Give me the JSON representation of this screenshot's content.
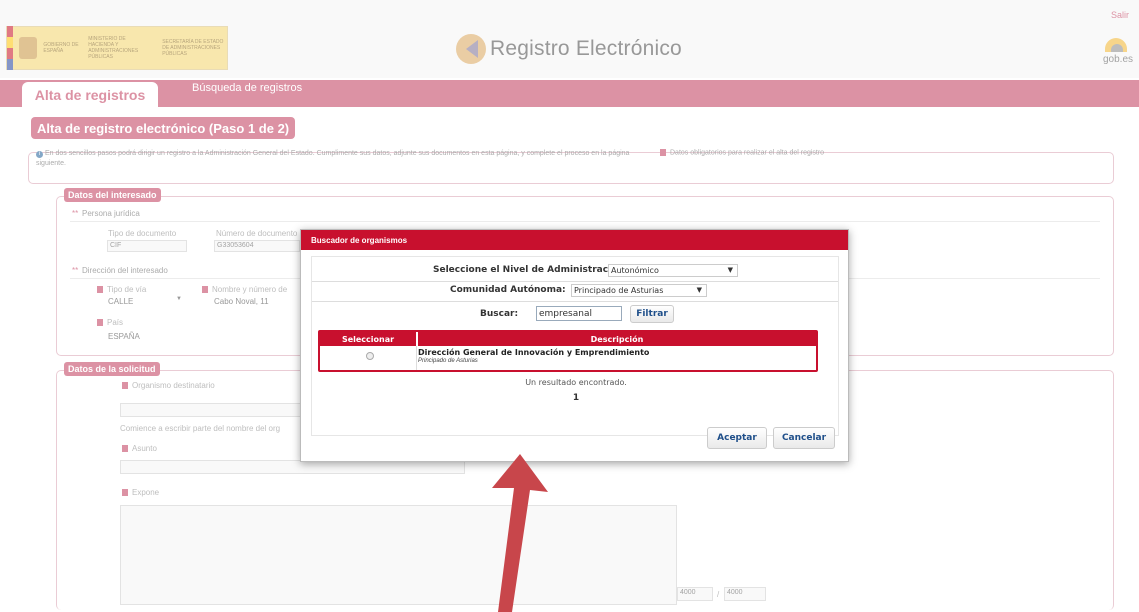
{
  "header": {
    "exit_link": "Salir",
    "brand_title": "Registro Electrónico",
    "gob_label": "gob.es",
    "gov_logo_line1": "GOBIERNO DE ESPAÑA",
    "gov_logo_line2": "MINISTERIO DE HACIENDA Y ADMINISTRACIONES PÚBLICAS",
    "gov_logo_line3": "SECRETARÍA DE ESTADO DE ADMINISTRACIONES PÚBLICAS"
  },
  "nav": {
    "tabs": [
      {
        "label": "Alta de registros"
      },
      {
        "label": "Búsqueda de registros"
      }
    ]
  },
  "page": {
    "title": "Alta de registro electrónico (Paso 1 de 2)",
    "info_text": "En dos sencillos pasos podrá dirigir un registro a la Administración General del Estado. Cumplimente sus datos, adjunte sus documentos en esta página, y complete el proceso en la página siguiente.",
    "required_note": "Datos obligatorios para realizar el alta del registro"
  },
  "interesado": {
    "section_title": "Datos del interesado",
    "persona_label": "Persona jurídica",
    "tipo_doc_label": "Tipo de documento",
    "tipo_doc_value": "CIF",
    "num_doc_label": "Número de documento",
    "num_doc_value": "G33053604",
    "direccion_label": "Dirección del interesado",
    "tipo_via_label": "Tipo de vía",
    "tipo_via_value": "CALLE",
    "nombre_via_label": "Nombre y número de",
    "nombre_via_value": "Cabo Noval, 11",
    "pais_label": "País",
    "pais_value": "ESPAÑA"
  },
  "solicitud": {
    "section_title": "Datos de la solicitud",
    "organismo_label": "Organismo destinatario",
    "organismo_hint": "Comience a escribir parte del nombre del org",
    "asunto_label": "Asunto",
    "expone_label": "Expone",
    "char_count": "4000",
    "char_max": "4000",
    "char_sep": "/"
  },
  "modal": {
    "title": "Buscador de organismos",
    "nivel_label": "Seleccione el Nivel de Administracion:",
    "nivel_value": "Autonómico",
    "comunidad_label": "Comunidad Autónoma:",
    "comunidad_value": "Principado de Asturias",
    "buscar_label": "Buscar:",
    "buscar_value": "empresanal",
    "filter_button": "Filtrar",
    "table_headers": [
      "Seleccionar",
      "Descripción"
    ],
    "result_main": "Dirección General de Innovación y Emprendimiento",
    "result_sub": "Principado de Asturias",
    "result_count": "Un resultado encontrado.",
    "page_number": "1",
    "accept_button": "Aceptar",
    "cancel_button": "Cancelar"
  },
  "colors": {
    "brand": "#c0395a",
    "modal_header": "#c8102e",
    "arrow": "#c8464b"
  }
}
